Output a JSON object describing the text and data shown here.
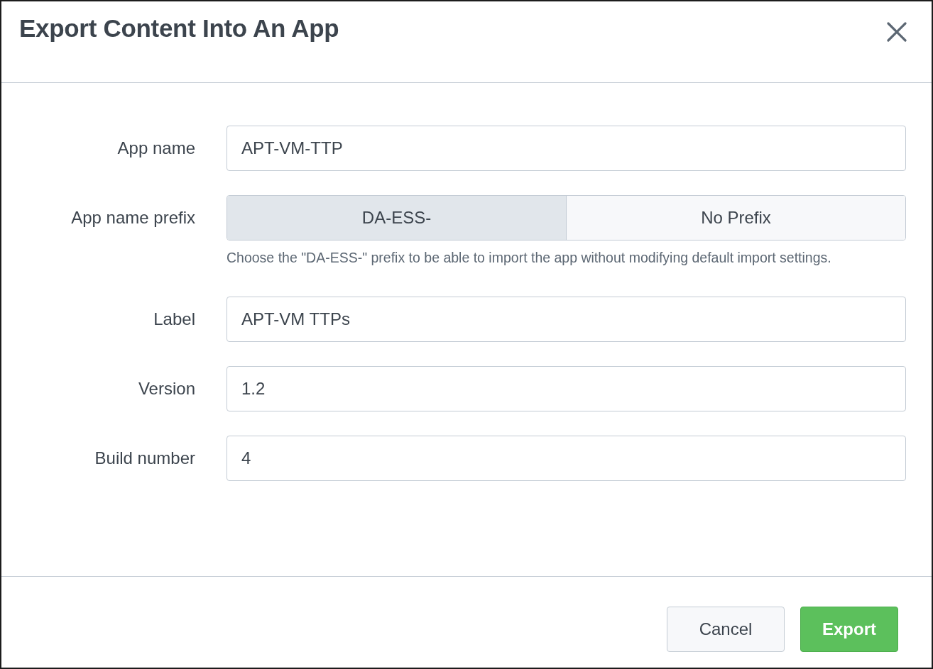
{
  "dialog": {
    "title": "Export Content Into An App"
  },
  "fields": [
    {
      "kind": "text",
      "label": "App name",
      "value": "APT-VM-TTP"
    },
    {
      "kind": "segmented",
      "label": "App name prefix",
      "options": [
        {
          "label": "DA-ESS-",
          "selected": true
        },
        {
          "label": "No Prefix",
          "selected": false
        }
      ],
      "help": "Choose the \"DA-ESS-\" prefix to be able to import the app without modifying default import settings."
    },
    {
      "kind": "text",
      "label": "Label",
      "value": "APT-VM TTPs"
    },
    {
      "kind": "text",
      "label": "Version",
      "value": "1.2"
    },
    {
      "kind": "text",
      "label": "Build number",
      "value": "4"
    }
  ],
  "buttons": [
    {
      "kind": "secondary",
      "label": "Cancel"
    },
    {
      "kind": "primary",
      "label": "Export"
    }
  ]
}
